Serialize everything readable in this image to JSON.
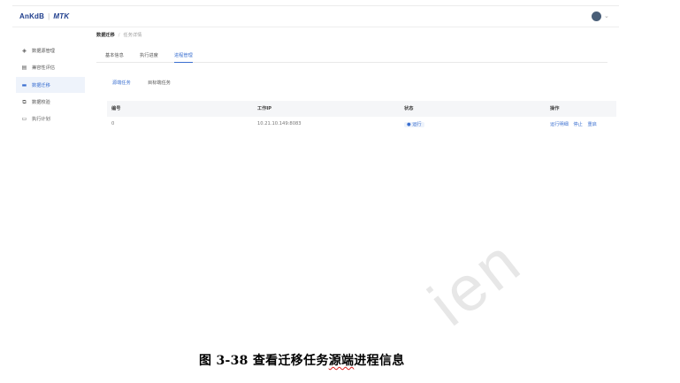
{
  "header": {
    "logo_brand": "AnKdB",
    "logo_product": "MTK"
  },
  "sidebar": {
    "items": [
      {
        "label": "数据源管理",
        "icon": "layers-icon",
        "active": false
      },
      {
        "label": "兼容性评估",
        "icon": "clipboard-icon",
        "active": false
      },
      {
        "label": "数据迁移",
        "icon": "folder-icon",
        "active": true
      },
      {
        "label": "数据校验",
        "icon": "copy-icon",
        "active": false
      },
      {
        "label": "执行计划",
        "icon": "calendar-icon",
        "active": false
      }
    ]
  },
  "breadcrumb": {
    "current": "数据迁移",
    "separator": "/",
    "child": "任务详情"
  },
  "tabs": [
    {
      "label": "基本信息",
      "active": false
    },
    {
      "label": "执行进度",
      "active": false
    },
    {
      "label": "进程管理",
      "active": true
    }
  ],
  "subtabs": [
    {
      "label": "源端任务",
      "active": true
    },
    {
      "label": "目标端任务",
      "active": false
    }
  ],
  "table": {
    "headers": [
      "编号",
      "工作IP",
      "状态",
      "操作"
    ],
    "rows": [
      {
        "id": "0",
        "ip": "10.21.10.149:8083",
        "status": "运行",
        "actions": [
          "运行明细",
          "停止",
          "重启"
        ]
      }
    ]
  },
  "caption": {
    "prefix": "图 3-38  查看迁移任务",
    "squiggle": "源端",
    "suffix": "进程信息"
  },
  "watermark": "ien",
  "colors": {
    "accent": "#3a6fd0",
    "brand": "#1d3c8c"
  }
}
